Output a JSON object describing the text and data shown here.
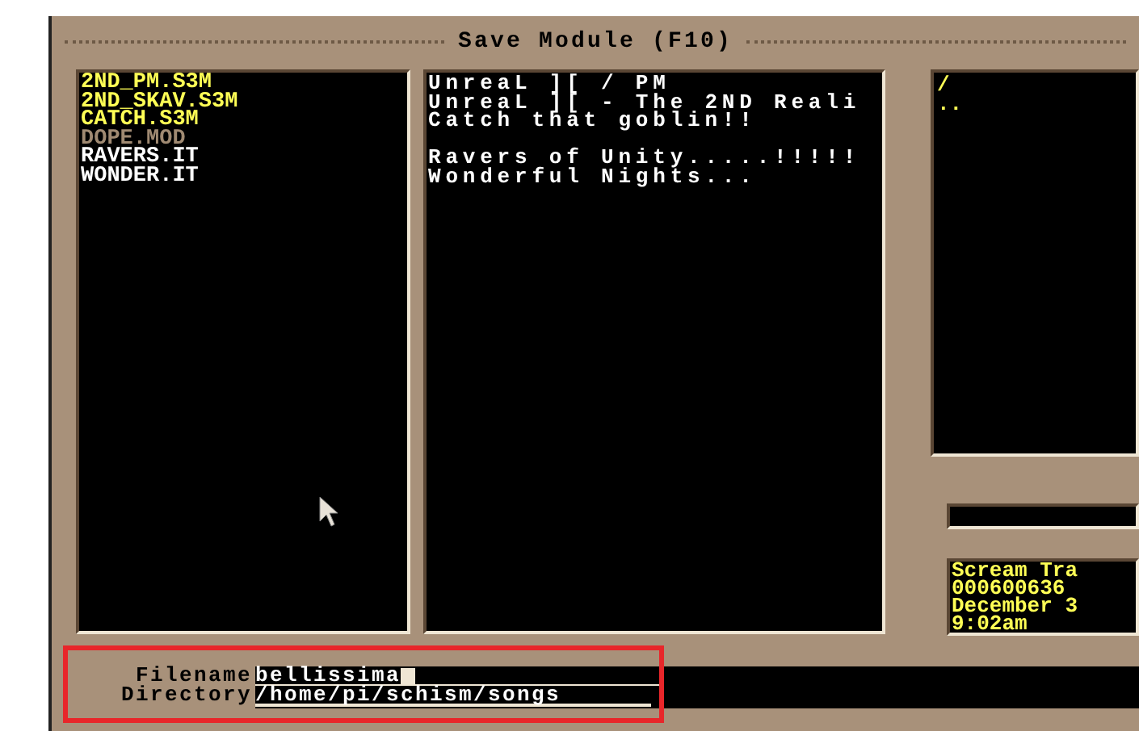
{
  "dialog": {
    "title": "Save Module (F10)"
  },
  "files": [
    {
      "name": "2ND_PM.S3M",
      "color": "#ffff55",
      "title": "UnreaL ][ / PM"
    },
    {
      "name": "2ND_SKAV.S3M",
      "color": "#ffff55",
      "title": "UnreaL ][ - The 2ND Reali"
    },
    {
      "name": "CATCH.S3M",
      "color": "#ffff55",
      "title": "Catch that goblin!!"
    },
    {
      "name": "DOPE.MOD",
      "color": "#a08a72"
    },
    {
      "name": "RAVERS.IT",
      "color": "#ffffff",
      "title": "Ravers of Unity.....!!!!!"
    },
    {
      "name": "WONDER.IT",
      "color": "#ffffff",
      "title": "Wonderful Nights..."
    }
  ],
  "directories": [
    "/",
    ".."
  ],
  "info": [
    "Scream Tra",
    "000600636",
    "December 3",
    "9:02am"
  ],
  "filename": {
    "label": "Filename",
    "value": "bellissima"
  },
  "directory": {
    "label": "Directory",
    "value": "/home/pi/schism/songs"
  }
}
